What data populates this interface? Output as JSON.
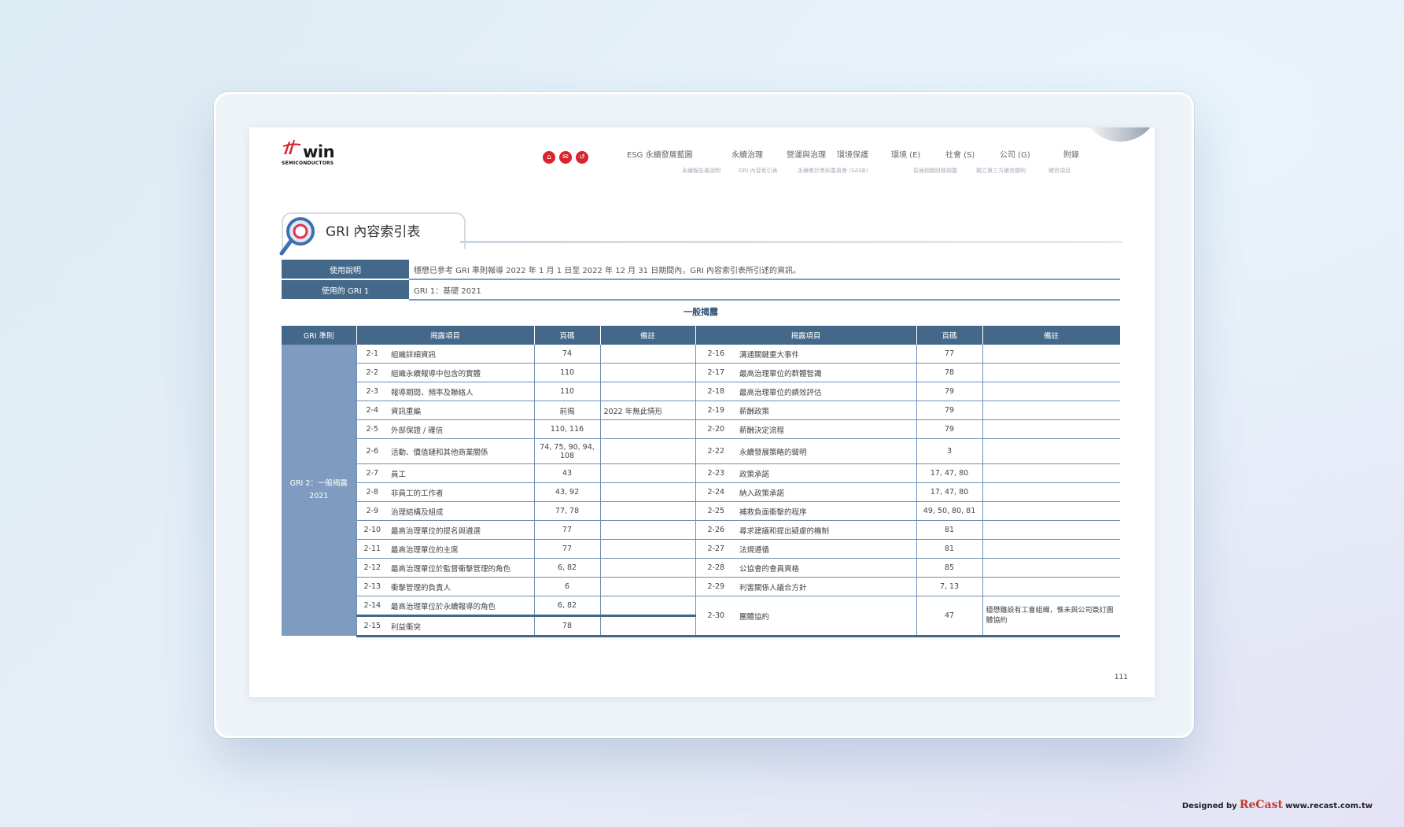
{
  "brand": {
    "word": "win",
    "sub": "SEMICONDUCTORS"
  },
  "circle_icons": [
    "home-icon",
    "mail-icon",
    "back-icon"
  ],
  "nav": [
    "ESG 永續發展藍圖",
    "永續治理",
    "營運與治理",
    "環境保護",
    "環境 (E)",
    "社會 (S)",
    "公司 (G)",
    "附錄"
  ],
  "subnav": [
    "永續報告書說明",
    "GRI 內容索引表",
    "永續會計準則委員會 (SASB)",
    "氣候相關財務揭露",
    "獨立第三方確信聲明",
    "確信項目"
  ],
  "title": "GRI 內容索引表",
  "info": [
    {
      "label": "使用說明",
      "value": "穩懋已參考 GRI 準則報導 2022 年 1 月 1 日至 2022 年 12 月 31 日期間內，GRI 內容索引表所引述的資訊。"
    },
    {
      "label": "使用的 GRI 1",
      "value": "GRI 1：基礎 2021"
    }
  ],
  "section": "一般揭露",
  "headers": {
    "standard": "GRI 準則",
    "item": "揭露項目",
    "page": "頁碼",
    "note": "備註"
  },
  "category": "GRI 2：一般揭露 2021",
  "rows": [
    {
      "c1": "2-1",
      "i1": "組織詳細資訊",
      "p1": "74",
      "n1": "",
      "c2": "2-16",
      "i2": "溝通關鍵重大事件",
      "p2": "77",
      "n2": ""
    },
    {
      "c1": "2-2",
      "i1": "組織永續報導中包含的實體",
      "p1": "110",
      "n1": "",
      "c2": "2-17",
      "i2": "最高治理單位的群體智識",
      "p2": "78",
      "n2": ""
    },
    {
      "c1": "2-3",
      "i1": "報導期間、頻率及聯絡人",
      "p1": "110",
      "n1": "",
      "c2": "2-18",
      "i2": "最高治理單位的績效評估",
      "p2": "79",
      "n2": ""
    },
    {
      "c1": "2-4",
      "i1": "資訊重編",
      "p1": "前揭",
      "n1": "2022 年無此情形",
      "c2": "2-19",
      "i2": "薪酬政策",
      "p2": "79",
      "n2": ""
    },
    {
      "c1": "2-5",
      "i1": "外部保證 / 確信",
      "p1": "110, 116",
      "n1": "",
      "c2": "2-20",
      "i2": "薪酬決定流程",
      "p2": "79",
      "n2": ""
    },
    {
      "c1": "2-6",
      "i1": "活動、價值鏈和其他商業關係",
      "p1": "74, 75, 90, 94, 108",
      "n1": "",
      "c2": "2-22",
      "i2": "永續發展策略的聲明",
      "p2": "3",
      "n2": ""
    },
    {
      "c1": "2-7",
      "i1": "員工",
      "p1": "43",
      "n1": "",
      "c2": "2-23",
      "i2": "政策承諾",
      "p2": "17, 47, 80",
      "n2": ""
    },
    {
      "c1": "2-8",
      "i1": "非員工的工作者",
      "p1": "43, 92",
      "n1": "",
      "c2": "2-24",
      "i2": "納入政策承諾",
      "p2": "17, 47, 80",
      "n2": ""
    },
    {
      "c1": "2-9",
      "i1": "治理結構及組成",
      "p1": "77, 78",
      "n1": "",
      "c2": "2-25",
      "i2": "補救負面衝擊的程序",
      "p2": "49, 50, 80, 81",
      "n2": ""
    },
    {
      "c1": "2-10",
      "i1": "最高治理單位的提名與遴選",
      "p1": "77",
      "n1": "",
      "c2": "2-26",
      "i2": "尋求建議和提出疑慮的機制",
      "p2": "81",
      "n2": ""
    },
    {
      "c1": "2-11",
      "i1": "最高治理單位的主席",
      "p1": "77",
      "n1": "",
      "c2": "2-27",
      "i2": "法規遵循",
      "p2": "81",
      "n2": ""
    },
    {
      "c1": "2-12",
      "i1": "最高治理單位於監督衝擊管理的角色",
      "p1": "6, 82",
      "n1": "",
      "c2": "2-28",
      "i2": "公協會的會員資格",
      "p2": "85",
      "n2": ""
    },
    {
      "c1": "2-13",
      "i1": "衝擊管理的負責人",
      "p1": "6",
      "n1": "",
      "c2": "2-29",
      "i2": "利害關係人議合方針",
      "p2": "7, 13",
      "n2": ""
    },
    {
      "c1": "2-14",
      "i1": "最高治理單位於永續報導的角色",
      "p1": "6, 82",
      "n1": "",
      "c2": "2-30",
      "i2": "團體協約",
      "p2": "47",
      "n2": "穩懋雖設有工會組織，惟未與公司簽訂團體協約"
    },
    {
      "c1": "2-15",
      "i1": "利益衝突",
      "p1": "78",
      "n1": ""
    }
  ],
  "page_number": "111",
  "credit": {
    "prefix": "Designed by",
    "brand": "ReCast",
    "url": "www.recast.com.tw"
  }
}
